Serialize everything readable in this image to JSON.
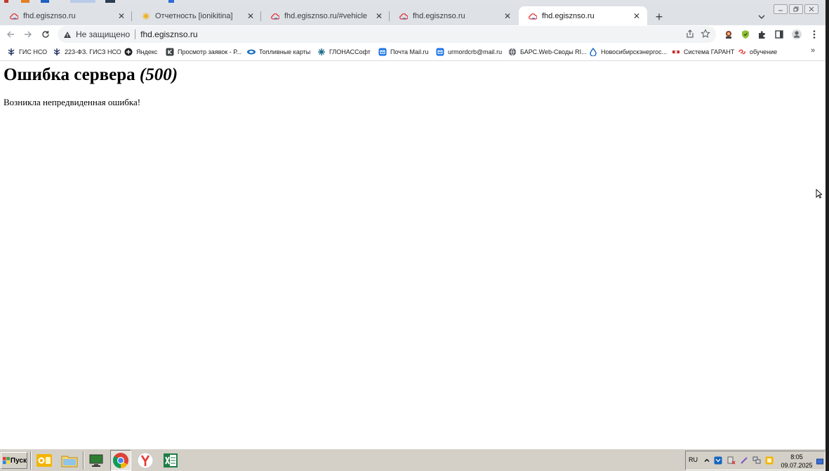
{
  "browser": {
    "tabs": [
      {
        "title": "fhd.egisznso.ru",
        "favicon": "cloud-icon",
        "active": false
      },
      {
        "title": "Отчетность [ionikitina]",
        "favicon": "sparkle-icon",
        "active": false
      },
      {
        "title": "fhd.egisznso.ru/#vehicle",
        "favicon": "cloud-icon",
        "active": false
      },
      {
        "title": "fhd.egisznso.ru",
        "favicon": "cloud-icon",
        "active": false
      },
      {
        "title": "fhd.egisznso.ru",
        "favicon": "cloud-icon",
        "active": true
      }
    ],
    "new_tab_label": "+",
    "close_glyph": "✕",
    "omnibox": {
      "security_label": "Не защищено",
      "url": "fhd.egisznso.ru"
    },
    "bookmarks": [
      {
        "label": "ГИС НСО",
        "icon": "emblem-icon"
      },
      {
        "label": "223-ФЗ. ГИСЗ НСО",
        "icon": "emblem-icon"
      },
      {
        "label": "Яндекс",
        "icon": "plus-circle-icon"
      },
      {
        "label": "Просмотр заявок - Р...",
        "icon": "k-icon"
      },
      {
        "label": "Топливные карты",
        "icon": "fuel-card-icon"
      },
      {
        "label": "ГЛОНАССофт",
        "icon": "glonass-icon"
      },
      {
        "label": "Почта Mail.ru",
        "icon": "mail-icon"
      },
      {
        "label": "urmordcrb@mail.ru",
        "icon": "mail-icon"
      },
      {
        "label": "БАРС.Web-Своды RI...",
        "icon": "globe-icon"
      },
      {
        "label": "Новосибирскэнергос...",
        "icon": "drop-icon"
      },
      {
        "label": "Система ГАРАНТ",
        "icon": "garant-icon"
      },
      {
        "label": "обучение",
        "icon": "swirl-icon"
      }
    ],
    "bookmarks_overflow": "»"
  },
  "page": {
    "heading_text": "Ошибка сервера",
    "heading_code": "(500)",
    "message": "Возникла непредвиденная ошибка!"
  },
  "taskbar": {
    "start_label": "Пуск",
    "apps": [
      "outlook-icon",
      "folder-icon",
      "monitor-icon",
      "chrome-icon",
      "yandex-browser-icon",
      "excel-icon"
    ],
    "language": "RU",
    "time": "8:05",
    "date": "09.07.2025"
  },
  "colors": {
    "tab_strip": "#dee1e6",
    "omnibox": "#f1f3f4",
    "taskbar": "#d4d0c8"
  }
}
